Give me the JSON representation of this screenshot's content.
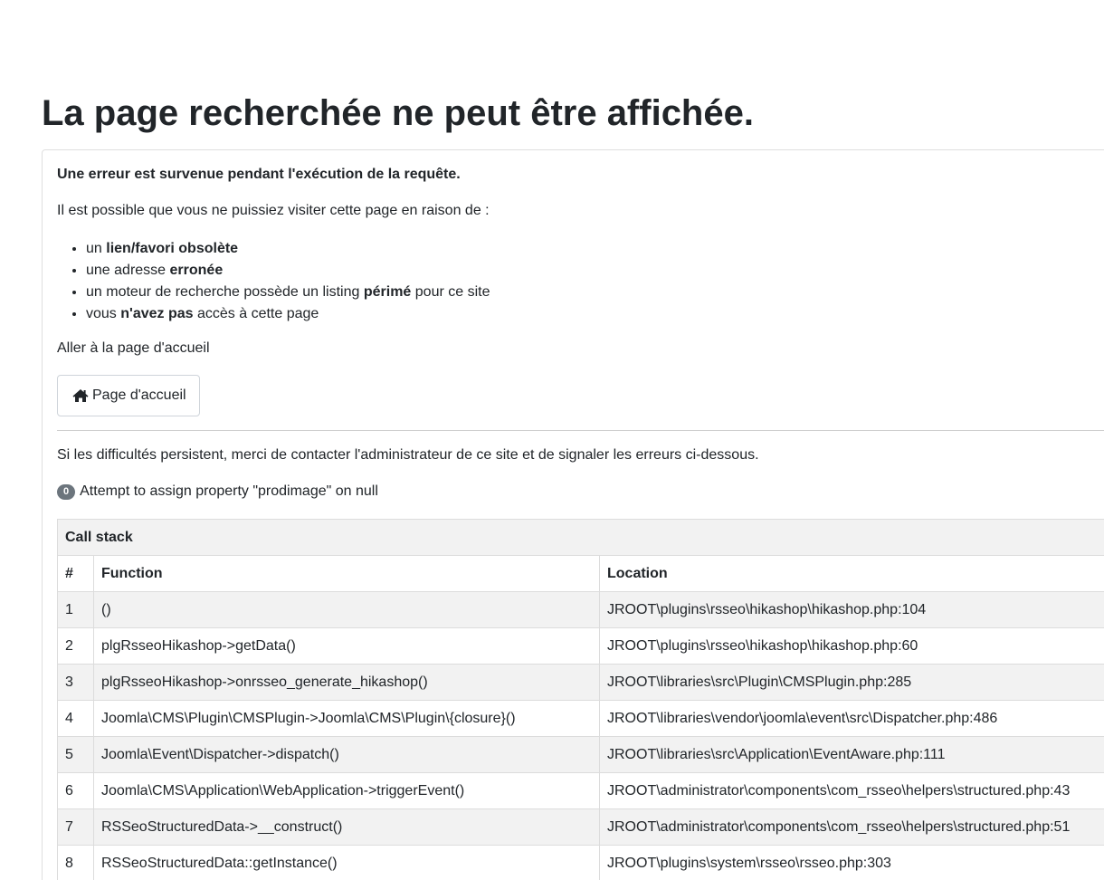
{
  "page_title": "La page recherchée ne peut être affichée.",
  "error_heading": "Une erreur est survenue pendant l'exécution de la requête.",
  "intro": "Il est possible que vous ne puissiez visiter cette page en raison de :",
  "reasons": [
    {
      "pre": "un ",
      "strong": "lien/favori obsolète",
      "post": ""
    },
    {
      "pre": "une adresse ",
      "strong": "erronée",
      "post": ""
    },
    {
      "pre": "un moteur de recherche possède un listing ",
      "strong": "périmé",
      "post": " pour ce site"
    },
    {
      "pre": "vous ",
      "strong": "n'avez pas",
      "post": " accès à cette page"
    }
  ],
  "goto_home_text": "Aller à la page d'accueil",
  "home_button": {
    "label": "Page d'accueil",
    "icon": "home-icon"
  },
  "contact_text": "Si les difficultés persistent, merci de contacter l'administrateur de ce site et de signaler les erreurs ci-dessous.",
  "error": {
    "code": "0",
    "message": "Attempt to assign property \"prodimage\" on null"
  },
  "call_stack": {
    "caption": "Call stack",
    "columns": [
      "#",
      "Function",
      "Location"
    ],
    "rows": [
      {
        "num": "1",
        "function": "()",
        "location": "JROOT\\plugins\\rsseo\\hikashop\\hikashop.php:104"
      },
      {
        "num": "2",
        "function": "plgRsseoHikashop->getData()",
        "location": "JROOT\\plugins\\rsseo\\hikashop\\hikashop.php:60"
      },
      {
        "num": "3",
        "function": "plgRsseoHikashop->onrsseo_generate_hikashop()",
        "location": "JROOT\\libraries\\src\\Plugin\\CMSPlugin.php:285"
      },
      {
        "num": "4",
        "function": "Joomla\\CMS\\Plugin\\CMSPlugin->Joomla\\CMS\\Plugin\\{closure}()",
        "location": "JROOT\\libraries\\vendor\\joomla\\event\\src\\Dispatcher.php:486"
      },
      {
        "num": "5",
        "function": "Joomla\\Event\\Dispatcher->dispatch()",
        "location": "JROOT\\libraries\\src\\Application\\EventAware.php:111"
      },
      {
        "num": "6",
        "function": "Joomla\\CMS\\Application\\WebApplication->triggerEvent()",
        "location": "JROOT\\administrator\\components\\com_rsseo\\helpers\\structured.php:43"
      },
      {
        "num": "7",
        "function": "RSSeoStructuredData->__construct()",
        "location": "JROOT\\administrator\\components\\com_rsseo\\helpers\\structured.php:51"
      },
      {
        "num": "8",
        "function": "RSSeoStructuredData::getInstance()",
        "location": "JROOT\\plugins\\system\\rsseo\\rsseo.php:303"
      }
    ]
  }
}
